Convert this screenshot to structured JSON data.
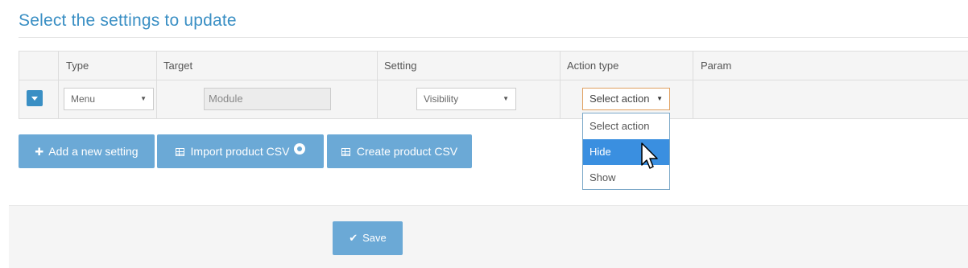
{
  "header": {
    "title": "Select the settings to update"
  },
  "table": {
    "columns": [
      "Type",
      "Target",
      "Setting",
      "Action type",
      "Param"
    ],
    "row": {
      "type_value": "Menu",
      "target_value": "Module",
      "setting_value": "Visibility",
      "action_value": "Select action"
    }
  },
  "dropdown": {
    "options": [
      "Select action",
      "Hide",
      "Show"
    ],
    "highlighted": "Hide"
  },
  "buttons": {
    "add_setting": "Add a new setting",
    "import_csv": "Import product CSV",
    "create_csv": "Create product CSV",
    "save": "Save"
  },
  "colors": {
    "accent": "#3a8fc4",
    "button": "#6ba9d6",
    "highlight": "#3a8fe0"
  },
  "icons": {
    "expand": "chevron-down-icon",
    "add": "plus-icon",
    "table": "table-grid-icon",
    "info": "info-circle-icon",
    "save": "checkmark-icon",
    "cursor": "hand-pointer-icon"
  }
}
